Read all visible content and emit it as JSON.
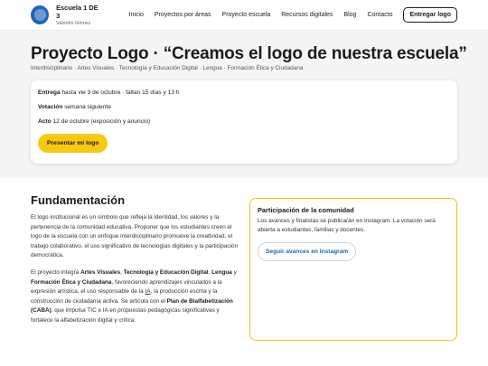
{
  "header": {
    "brand_name": "Escuela 1 DE 3",
    "brand_sub": "Valentín Gómez",
    "nav": [
      "Inicio",
      "Proyectos por áreas",
      "Proyecto escuela",
      "Recursos digitales",
      "Blog",
      "Contacto"
    ],
    "cta": "Entregar logo"
  },
  "hero": {
    "title": "Proyecto Logo · “Creamos el logo de nuestra escuela”",
    "areas": "Interdisciplinario · Artes Visuales · Tecnología y Educación Digital · Lengua · Formación Ética y Ciudadana",
    "rows": [
      {
        "label": "Entrega",
        "text": " hasta vie 3 de octubre · faltan 15 días y 13 h"
      },
      {
        "label": "Votación",
        "text": " semana siguiente"
      },
      {
        "label": "Acto",
        "text": " 12 de octubre (exposición y anuncio)"
      }
    ],
    "button": "Presentar mi logo"
  },
  "fundamentacion": {
    "title": "Fundamentación",
    "p1": "El logo institucional es un símbolo que refleja la identidad, los valores y la pertenencia de la comunidad educativa. Proponer que los estudiantes creen el logo de la escuela con un enfoque interdisciplinario promueve la creatividad, el trabajo colaborativo, el uso significativo de tecnologías digitales y la participación democrática.",
    "p2": {
      "a": "El proyecto integra ",
      "b1": "Artes Visuales",
      "c1": ", ",
      "b2": "Tecnología y Educación Digital",
      "c2": ", ",
      "b3": "Lengua",
      "c3": " y ",
      "b4": "Formación Ética y Ciudadana",
      "d": ", favoreciendo aprendizajes vinculados a la expresión artística, el uso responsable de la ",
      "ia": "IA",
      "e": ", la producción escrita y la construcción de ciudadanía activa. Se articula con el ",
      "b5": "Plan de Bialfabetización (CABA)",
      "f": ", que impulsa TIC e IA en propuestas pedagógicas significativas y fortalece la alfabetización digital y crítica."
    }
  },
  "community": {
    "title": "Participación de la comunidad",
    "text": "Los avances y finalistas se publicarán en Instagram. La votación será abierta a estudiantes, familias y docentes.",
    "button": "Seguir avances en Instagram"
  },
  "colors": {
    "accent_yellow": "#f9c813",
    "brand_blue": "#1e66b8"
  }
}
